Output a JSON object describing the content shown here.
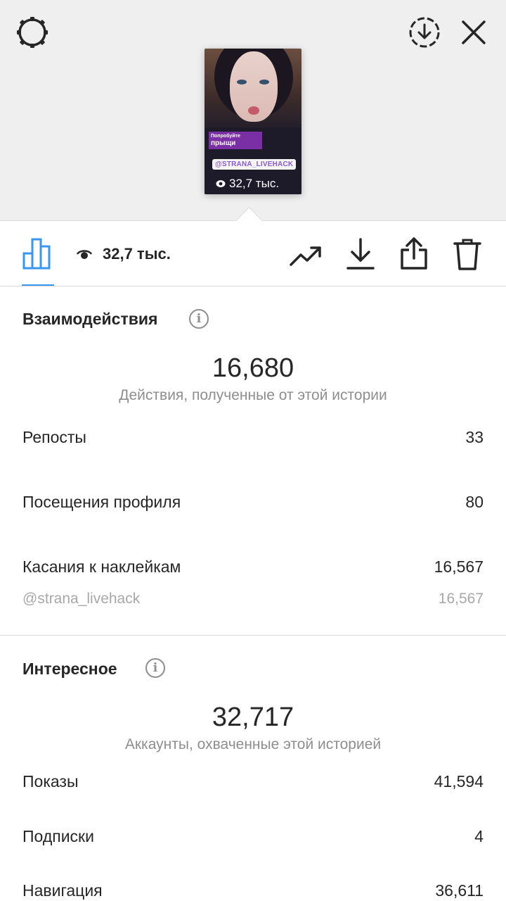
{
  "header": {
    "settings_icon": "gear-icon",
    "download_icon": "circle-download-icon",
    "close_icon": "close-icon"
  },
  "story_preview": {
    "sticker_text_line1": "Попробуйте",
    "sticker_text_line2": "прыщи",
    "mention_sticker": "@STRANA_LIVEHACK",
    "views": "32,7 тыс."
  },
  "toolbar": {
    "views_count": "32,7 тыс.",
    "icons": [
      "bar-chart-icon",
      "eye-icon",
      "trending-icon",
      "download-icon",
      "share-icon",
      "trash-icon"
    ],
    "accent_color": "#3897f0"
  },
  "interactions": {
    "title": "Взаимодействия",
    "total": "16,680",
    "caption": "Действия, полученные от этой истории",
    "rows": [
      {
        "label": "Репосты",
        "value": "33"
      },
      {
        "label": "Посещения профиля",
        "value": "80"
      },
      {
        "label": "Касания к наклейкам",
        "value": "16,567"
      }
    ],
    "sub_row": {
      "label": "@strana_livehack",
      "value": "16,567"
    }
  },
  "discovery": {
    "title": "Интересное",
    "total": "32,717",
    "caption": "Аккаунты, охваченные этой историей",
    "rows": [
      {
        "label": "Показы",
        "value": "41,594"
      },
      {
        "label": "Подписки",
        "value": "4"
      },
      {
        "label": "Навигация",
        "value": "36,611"
      }
    ]
  }
}
